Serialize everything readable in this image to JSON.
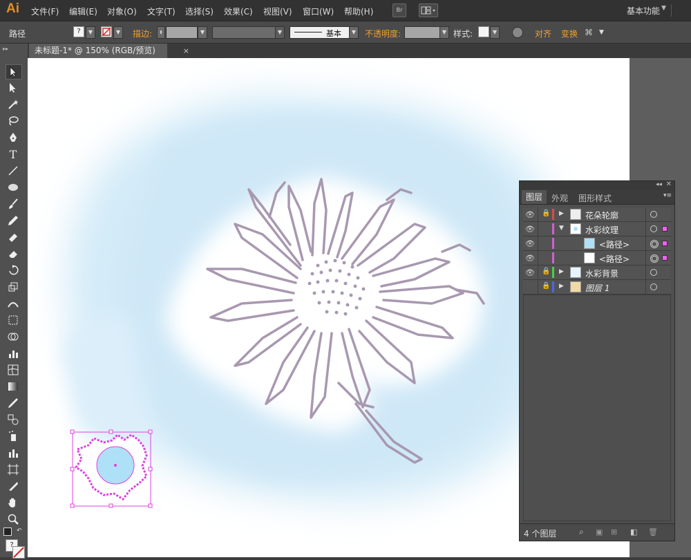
{
  "app": {
    "logo": "Ai"
  },
  "menu": [
    "文件(F)",
    "编辑(E)",
    "对象(O)",
    "文字(T)",
    "选择(S)",
    "效果(C)",
    "视图(V)",
    "窗口(W)",
    "帮助(H)"
  ],
  "menubar_buttons": {
    "bridge": "Br"
  },
  "workspace": "基本功能",
  "control": {
    "object_type": "路径",
    "stroke_label": "描边:",
    "stroke_style": "基本",
    "opacity_label": "不透明度:",
    "style_label": "样式:",
    "align_label": "对齐",
    "transform_label": "变换"
  },
  "document_tab": {
    "title": "未标题-1* @ 150% (RGB/预览)",
    "close": "×"
  },
  "layers_panel": {
    "tabs": [
      "图层",
      "外观",
      "图形样式"
    ],
    "rows": [
      {
        "name": "花朵轮廓",
        "color": "#e04a4a"
      },
      {
        "name": "水彩纹理",
        "color": "#d060d0"
      },
      {
        "name": "<路径>",
        "color": "#d060d0"
      },
      {
        "name": "<路径>",
        "color": "#d060d0"
      },
      {
        "name": "水彩背景",
        "color": "#4ad04a"
      },
      {
        "name": "图层 1",
        "color": "#4a6ae0"
      }
    ],
    "footer_count": "4 个图层"
  },
  "colors": {
    "watercolor": "#d3ebf8",
    "flower_outline": "#a898b0",
    "selection": "#e040e0",
    "accent_orange": "#f0a030"
  }
}
